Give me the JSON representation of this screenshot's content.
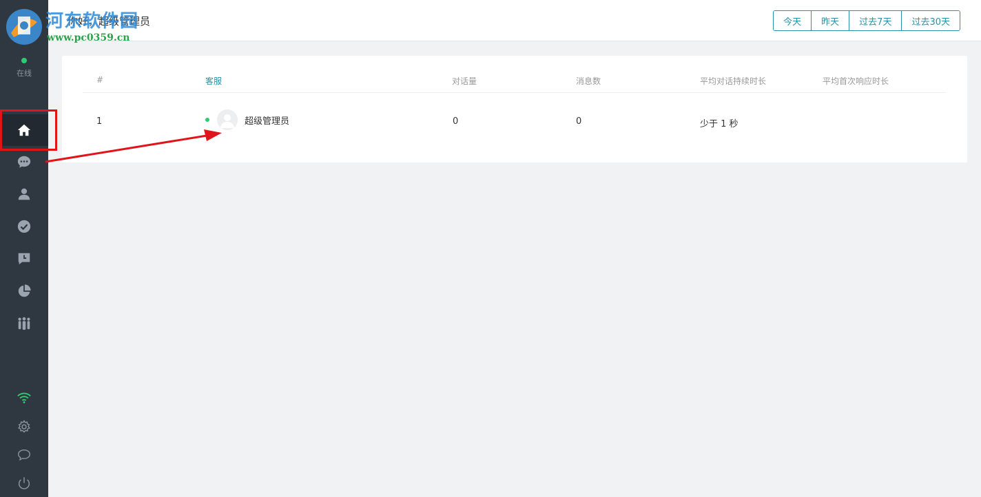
{
  "watermark": {
    "title": "河东软件园",
    "url": "www.pc0359.cn"
  },
  "sidebar": {
    "status_label": "在线",
    "nav": [
      {
        "icon": "home-icon",
        "active": true
      },
      {
        "icon": "chat-bubble-icon",
        "active": false
      },
      {
        "icon": "user-icon",
        "active": false
      },
      {
        "icon": "check-circle-icon",
        "active": false
      },
      {
        "icon": "clock-message-icon",
        "active": false
      },
      {
        "icon": "pie-chart-icon",
        "active": false
      },
      {
        "icon": "team-icon",
        "active": false
      }
    ],
    "bottom": [
      "wifi-icon",
      "settings-gear-icon",
      "speech-bubble-icon",
      "power-icon"
    ]
  },
  "header": {
    "greeting": "你好，超级管理员",
    "ranges": [
      "今天",
      "昨天",
      "过去7天",
      "过去30天"
    ]
  },
  "table": {
    "columns": [
      "#",
      "客服",
      "对话量",
      "消息数",
      "平均对话持续时长",
      "平均首次响应时长"
    ],
    "rows": [
      {
        "index": "1",
        "name": "超级管理员",
        "online": true,
        "conversations": "0",
        "messages": "0",
        "avg_duration": "少于 1 秒",
        "avg_first_response": ""
      }
    ]
  },
  "colors": {
    "sidebar": "#2f3740",
    "accent": "#2a8fa8",
    "online": "#2ecc71",
    "annotation": "#e0151b"
  }
}
